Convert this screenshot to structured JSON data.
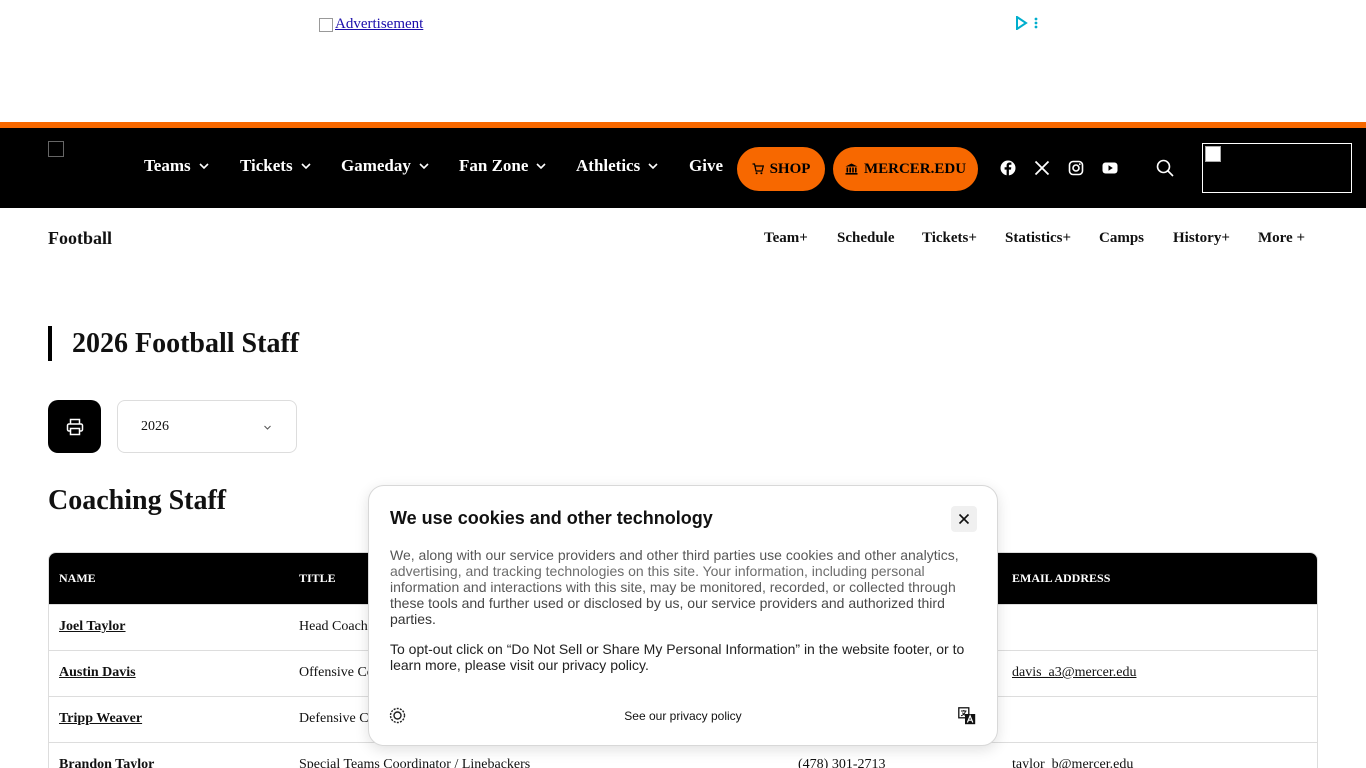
{
  "ad": {
    "label": "Advertisement"
  },
  "colors": {
    "brand_orange": "#f76800",
    "nav_bg": "#000000"
  },
  "main_nav": {
    "items": [
      {
        "label": "Teams",
        "has_dropdown": true
      },
      {
        "label": "Tickets",
        "has_dropdown": true
      },
      {
        "label": "Gameday",
        "has_dropdown": true
      },
      {
        "label": "Fan Zone",
        "has_dropdown": true
      },
      {
        "label": "Athletics",
        "has_dropdown": true
      },
      {
        "label": "Give",
        "has_dropdown": false
      }
    ],
    "shop_label": "SHOP",
    "mercer_label": "MERCER.EDU",
    "social_icons": [
      "facebook-icon",
      "x-icon",
      "instagram-icon",
      "youtube-icon"
    ]
  },
  "sub_nav": {
    "sport": "Football",
    "items": [
      "Team+",
      "Schedule",
      "Tickets+",
      "Statistics+",
      "Camps",
      "History+",
      "More +"
    ]
  },
  "page": {
    "heading": "2026 Football Staff",
    "season_value": "2026",
    "section_title": "Coaching Staff"
  },
  "table": {
    "headers": {
      "name": "NAME",
      "title": "TITLE",
      "email": "EMAIL ADDRESS"
    },
    "rows": [
      {
        "name": "Joel Taylor",
        "title": "Head Coach",
        "phone": "",
        "email": ""
      },
      {
        "name": "Austin Davis",
        "title": "Offensive Co",
        "phone": "",
        "email": "davis_a3@mercer.edu"
      },
      {
        "name": "Tripp Weaver",
        "title": "Defensive C",
        "phone": "",
        "email": ""
      },
      {
        "name": "Brandon Taylor",
        "title": "Special Teams Coordinator / Linebackers",
        "phone": "(478) 301-2713",
        "email": "taylor_b@mercer.edu"
      }
    ]
  },
  "cookie": {
    "title": "We use cookies and other technology",
    "body_1": "We, along with our service providers and other third parties use cookies and other analytics, advertising, and tracking technologies on this site. Your information, including personal information and interactions with this site, may be monitored, recorded, or collected through these tools and further used or disclosed by us, our service providers and authorized third parties.",
    "body_2": "To opt-out click on “Do Not Sell or Share My Personal Information” in the website footer, or to learn more, please visit our privacy policy.",
    "privacy_link": "See our privacy policy"
  }
}
